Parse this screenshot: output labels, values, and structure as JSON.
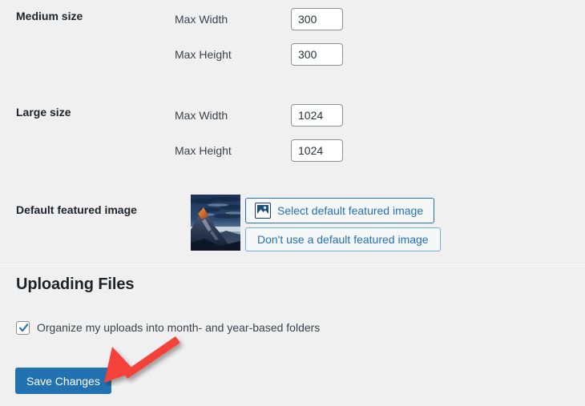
{
  "settings_rows": [
    {
      "label": "Medium size",
      "fields": [
        {
          "label": "Max Width",
          "value": "300"
        },
        {
          "label": "Max Height",
          "value": "300"
        }
      ]
    },
    {
      "label": "Large size",
      "fields": [
        {
          "label": "Max Width",
          "value": "1024"
        },
        {
          "label": "Max Height",
          "value": "1024"
        }
      ]
    }
  ],
  "featured_image": {
    "label": "Default featured image",
    "thumbnail_alt": "mountain-peak-at-dusk-thumbnail",
    "select_button": {
      "label": "Select default featured image",
      "icon": "image-icon"
    },
    "clear_button": {
      "label": "Don't use a default featured image"
    }
  },
  "uploading_files": {
    "heading": "Uploading Files",
    "organize_checkbox": {
      "label": "Organize my uploads into month- and year-based folders",
      "checked": true,
      "icon": "checkmark-icon"
    }
  },
  "save": {
    "label": "Save Changes"
  },
  "annotation": {
    "arrow": "red-arrow-pointing-to-save-changes"
  },
  "colors": {
    "background": "#f0f0f1",
    "heading_text": "#1d2327",
    "body_text": "#3c434a",
    "primary_blue": "#2271b1",
    "light_blue_border": "#72aee6",
    "input_border": "#8c8f94",
    "annotation_red": "#f4433a"
  }
}
